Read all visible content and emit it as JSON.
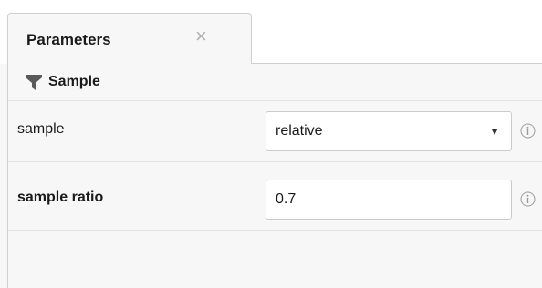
{
  "panel": {
    "tab_title": "Parameters",
    "tab_close": "×",
    "section_title": "Sample"
  },
  "rows": [
    {
      "label": "sample",
      "control": "select",
      "value": "relative",
      "caret": "▼"
    },
    {
      "label": "sample ratio",
      "control": "input",
      "value": "0.7"
    }
  ],
  "colors": {
    "funnel": "#5a5a5a",
    "border": "#cfcfcf",
    "info_icon": "#9a9a9a"
  },
  "icons": [
    "close-icon",
    "funnel-icon",
    "chevron-down-icon",
    "info-icon"
  ]
}
